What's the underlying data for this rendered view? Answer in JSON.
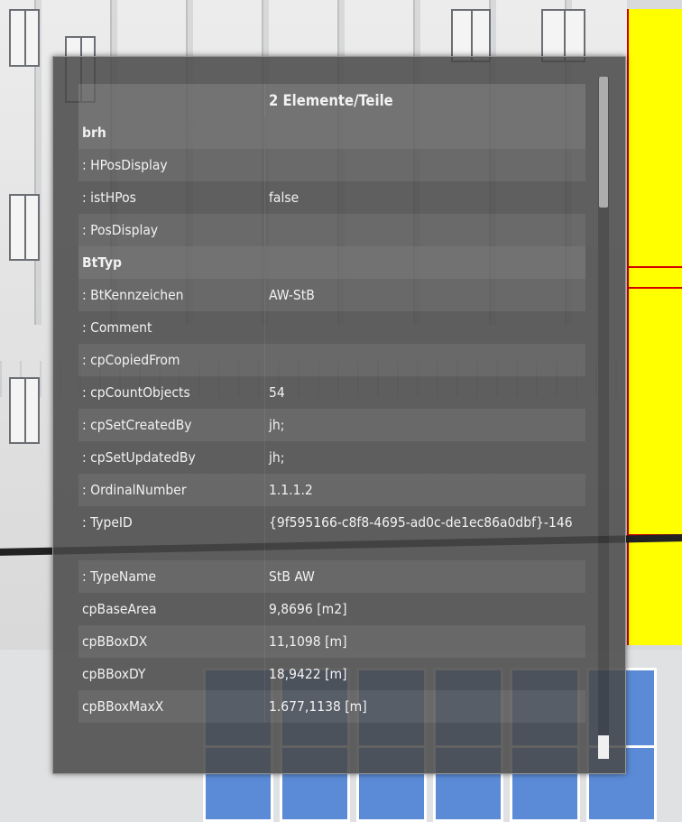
{
  "panel": {
    "title": "2 Elemente/Teile",
    "rows": [
      {
        "key": "brh",
        "value": "",
        "section": true
      },
      {
        "key": ": HPosDisplay",
        "value": ""
      },
      {
        "key": ": istHPos",
        "value": "false"
      },
      {
        "key": ": PosDisplay",
        "value": ""
      },
      {
        "key": "BtTyp",
        "value": "",
        "section": true
      },
      {
        "key": ": BtKennzeichen",
        "value": "AW-StB"
      },
      {
        "key": ": Comment",
        "value": ""
      },
      {
        "key": ": cpCopiedFrom",
        "value": ""
      },
      {
        "key": ": cpCountObjects",
        "value": "54"
      },
      {
        "key": ": cpSetCreatedBy",
        "value": "jh;"
      },
      {
        "key": ": cpSetUpdatedBy",
        "value": "jh;"
      },
      {
        "key": ": OrdinalNumber",
        "value": "1.1.1.2"
      },
      {
        "key": ": TypeID",
        "value": "{9f595166-c8f8-4695-ad0c-de1ec86a0dbf}-146"
      },
      {
        "key": ": TypeName",
        "value": "StB AW"
      },
      {
        "key": "cpBaseArea",
        "value": "9,8696 [m2]"
      },
      {
        "key": "cpBBoxDX",
        "value": "11,1098 [m]"
      },
      {
        "key": "cpBBoxDY",
        "value": "18,9422 [m]"
      },
      {
        "key": "cpBBoxMaxX",
        "value": "1.677,1138 [m]"
      }
    ]
  },
  "colors": {
    "panel_bg": "#484848",
    "highlight_wall": "#ffff00",
    "wall_edge": "#d40000",
    "window_glass": "#5b8bd6"
  }
}
